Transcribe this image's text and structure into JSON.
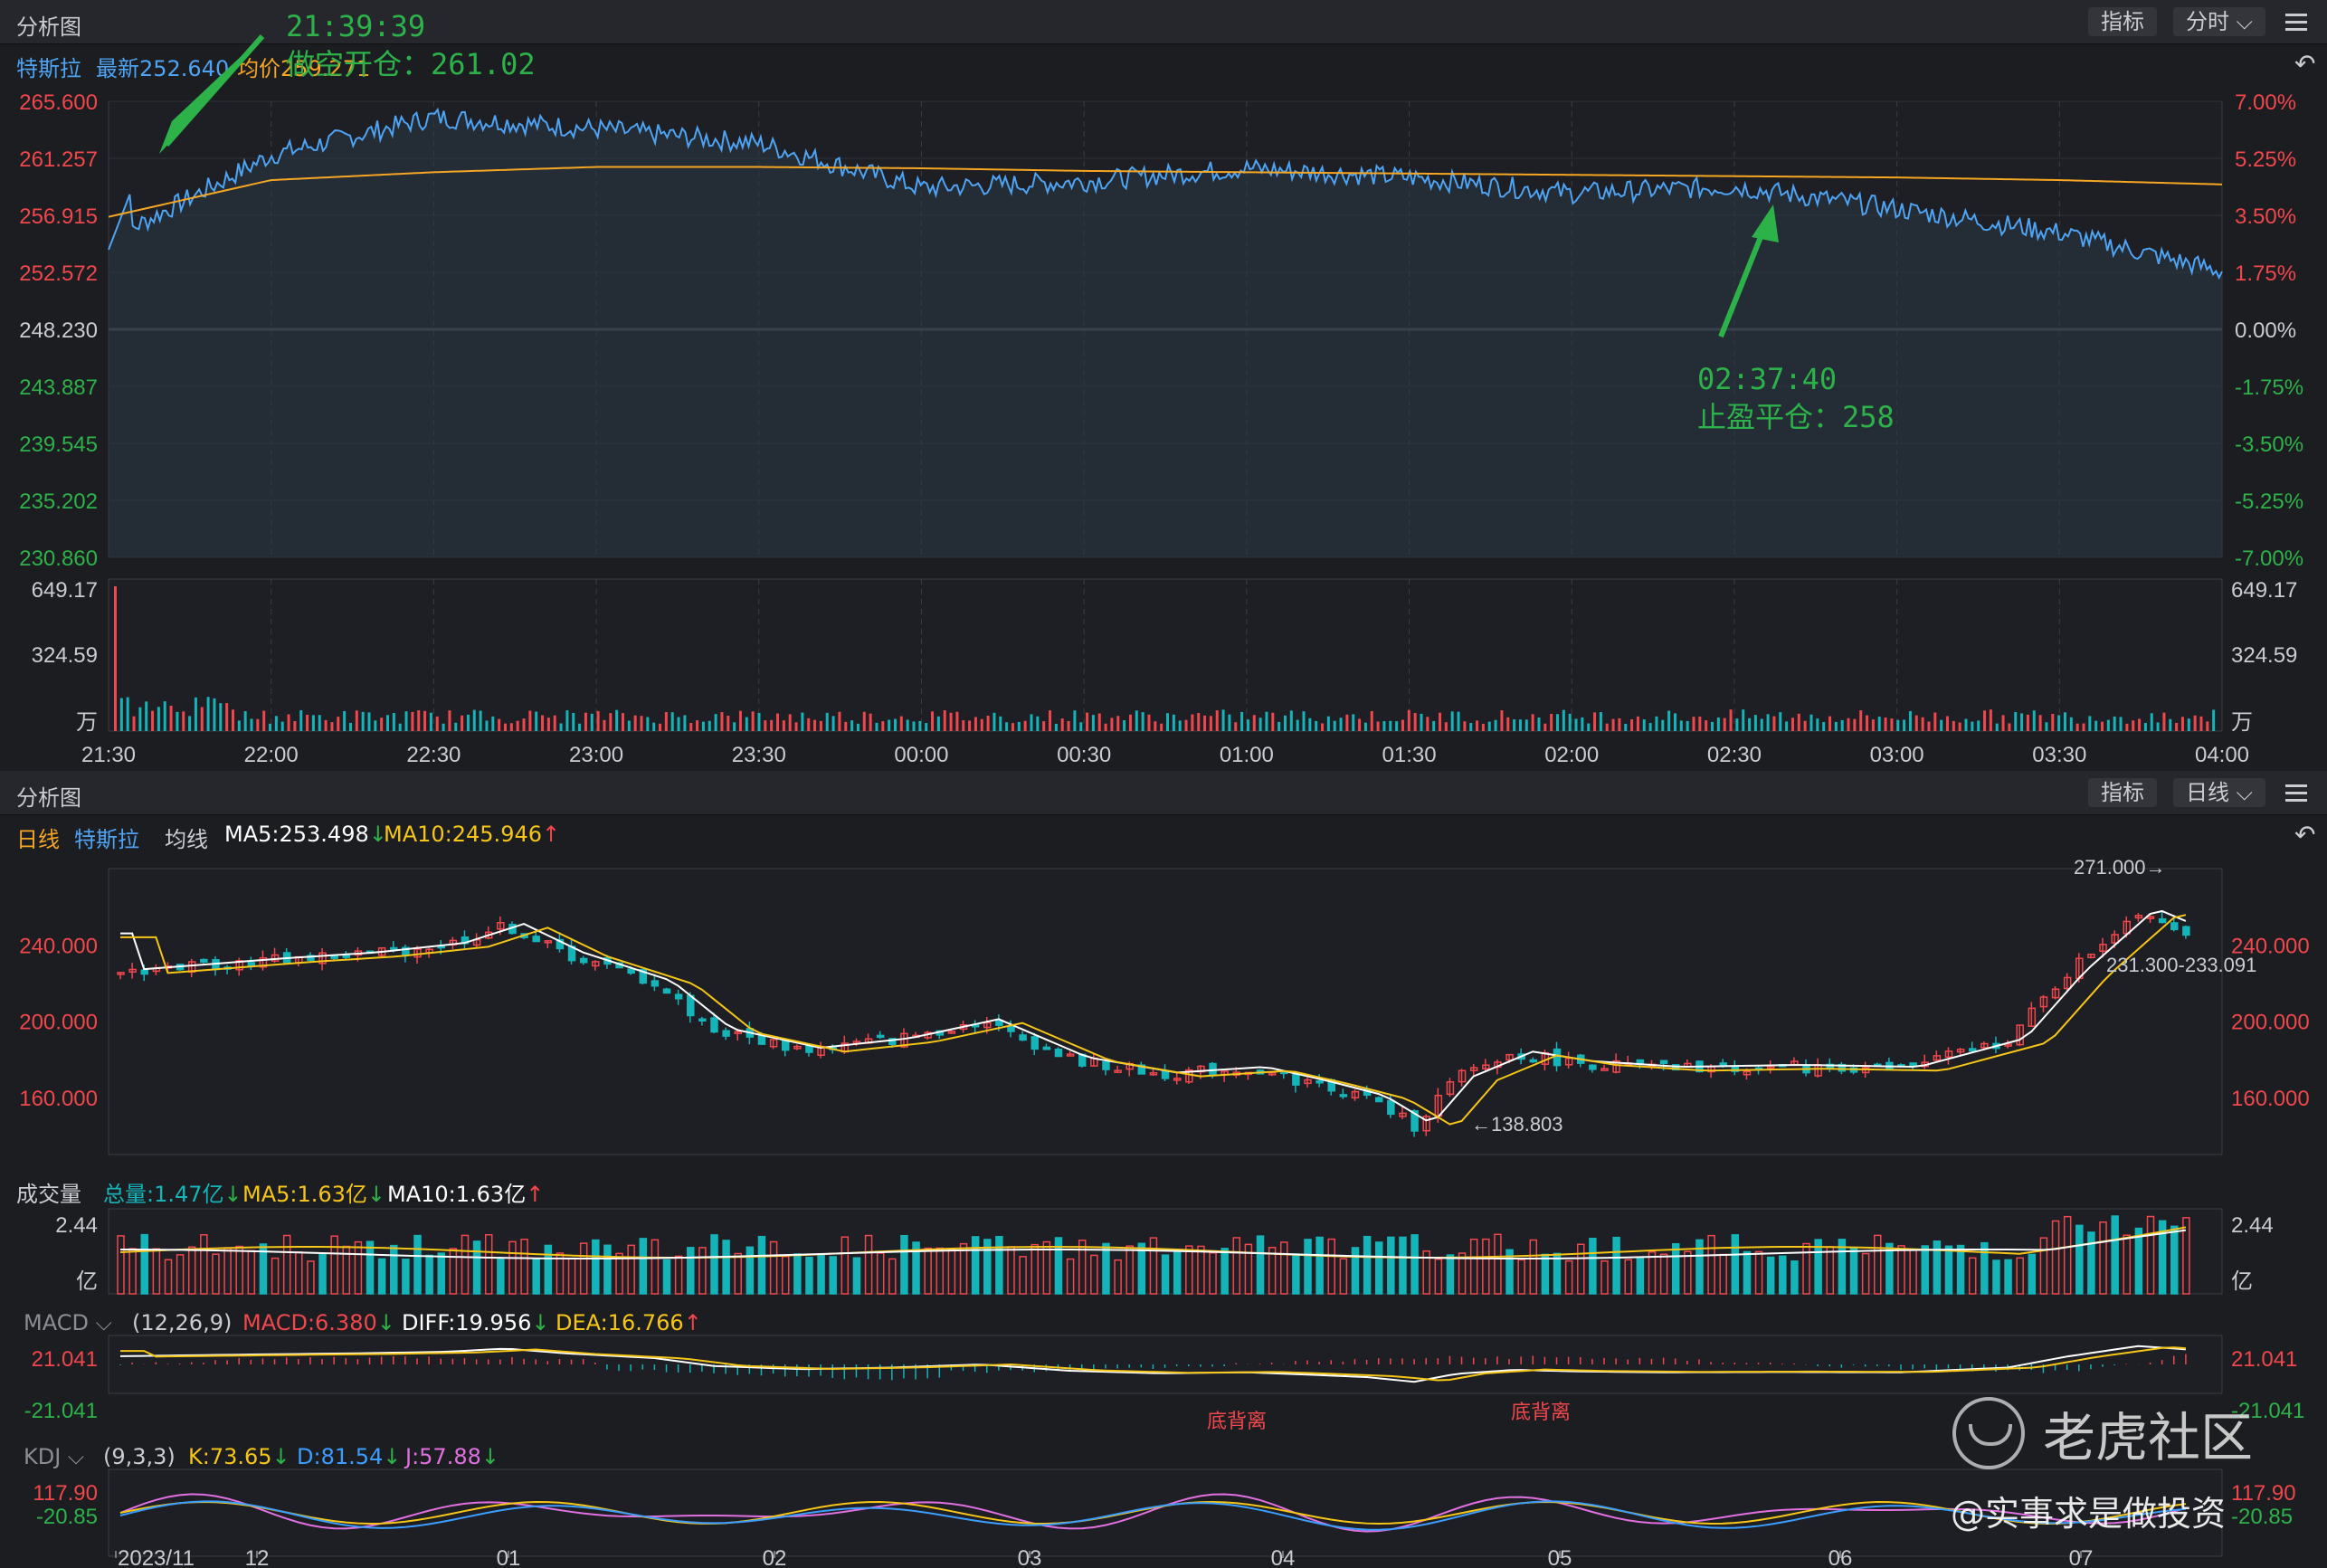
{
  "top_panel": {
    "title": "分析图",
    "btn_indicator": "指标",
    "btn_period": "分时",
    "stock_name": "特斯拉",
    "latest": "最新252.640",
    "avg_price": "均价259.271",
    "undo_icon": "undo-icon",
    "menu_icon": "menu-icon"
  },
  "top_annotations": {
    "entry_time": "21:39:39",
    "entry_text": "做空开仓：261.02",
    "exit_time": "02:37:40",
    "exit_text": "止盈平仓：258"
  },
  "intraday_axis": {
    "left_prices": [
      "265.600",
      "261.257",
      "256.915",
      "252.572",
      "248.230",
      "243.887",
      "239.545",
      "235.202",
      "230.860"
    ],
    "right_pcts": [
      "7.00%",
      "5.25%",
      "3.50%",
      "1.75%",
      "0.00%",
      "-1.75%",
      "-3.50%",
      "-5.25%",
      "-7.00%"
    ],
    "vol_left": [
      "649.17",
      "324.59",
      "万"
    ],
    "vol_right": [
      "649.17",
      "324.59",
      "万"
    ],
    "times": [
      "21:30",
      "22:00",
      "22:30",
      "23:00",
      "23:30",
      "00:00",
      "00:30",
      "01:00",
      "01:30",
      "02:00",
      "02:30",
      "03:00",
      "03:30",
      "04:00"
    ]
  },
  "bottom_panel": {
    "title": "分析图",
    "btn_indicator": "指标",
    "btn_period": "日线",
    "period_label": "日线",
    "stock_name": "特斯拉",
    "ma_label": "均线",
    "ma5": "MA5:253.498",
    "ma10": "MA10:245.946",
    "price_left": [
      "240.000",
      "200.000",
      "160.000"
    ],
    "price_right": [
      "240.000",
      "200.000",
      "160.000"
    ],
    "high_label": "271.000→",
    "range_label": "231.300-233.091",
    "low_label": "←138.803",
    "vol_title": "成交量",
    "vol_total": "总量:1.47亿",
    "vol_ma5": "MA5:1.63亿",
    "vol_ma10": "MA10:1.63亿",
    "vol_left": [
      "2.44",
      "亿"
    ],
    "vol_right": [
      "2.44",
      "亿"
    ],
    "macd_title": "MACD",
    "macd_params": "(12,26,9)",
    "macd_val": "MACD:6.380",
    "diff_val": "DIFF:19.956",
    "dea_val": "DEA:16.766",
    "macd_left": [
      "21.041",
      "-21.041"
    ],
    "macd_right": [
      "21.041",
      "-21.041"
    ],
    "divergence": [
      "底背离",
      "底背离"
    ],
    "kdj_title": "KDJ",
    "kdj_params": "(9,3,3)",
    "k_val": "K:73.65",
    "d_val": "D:81.54",
    "j_val": "J:57.88",
    "kdj_left": [
      "117.90",
      "-20.85"
    ],
    "kdj_right": [
      "117.90",
      "-20.85"
    ],
    "dates": [
      "2023/11",
      "12",
      "01",
      "02",
      "03",
      "04",
      "05",
      "06",
      "07"
    ]
  },
  "watermark": {
    "brand": "老虎社区",
    "author": "@实事求是做投资"
  },
  "colors": {
    "up": "#f0474d",
    "down": "#15b4b9",
    "price_line": "#4ea3f2",
    "avg_line": "#f5a623",
    "annotation": "#2db24a",
    "ma5": "#ffffff",
    "ma10": "#f5c518",
    "kdj_k": "#f5c518",
    "kdj_d": "#3b9dff",
    "kdj_j": "#e070e0"
  },
  "chart_data": [
    {
      "type": "line",
      "title": "特斯拉 分时",
      "x": [
        "21:30",
        "22:00",
        "22:30",
        "23:00",
        "23:30",
        "00:00",
        "00:30",
        "01:00",
        "01:30",
        "02:00",
        "02:30",
        "03:00",
        "03:30",
        "04:00"
      ],
      "series": [
        {
          "name": "最新",
          "values": [
            255.0,
            261.5,
            264.4,
            263.5,
            262.4,
            259.0,
            259.5,
            260.5,
            259.8,
            258.6,
            259.1,
            257.4,
            255.6,
            252.64
          ]
        },
        {
          "name": "均价",
          "values": [
            256.8,
            259.6,
            260.2,
            260.6,
            260.6,
            260.5,
            260.3,
            260.2,
            260.1,
            260.0,
            259.9,
            259.8,
            259.6,
            259.271
          ]
        }
      ],
      "ylim": [
        230.86,
        265.6
      ]
    },
    {
      "type": "bar",
      "title": "特斯拉 日线",
      "categories": [
        "2023/11",
        "12",
        "01",
        "02",
        "03",
        "04",
        "05",
        "06",
        "07"
      ],
      "series": [
        {
          "name": "MA5",
          "values": [
            225,
            240,
            243,
            185,
            195,
            170,
            155,
            180,
            253.498
          ]
        },
        {
          "name": "MA10",
          "values": [
            220,
            238,
            245,
            190,
            193,
            172,
            160,
            178,
            245.946
          ]
        }
      ],
      "ylim": [
        130,
        280
      ]
    }
  ]
}
